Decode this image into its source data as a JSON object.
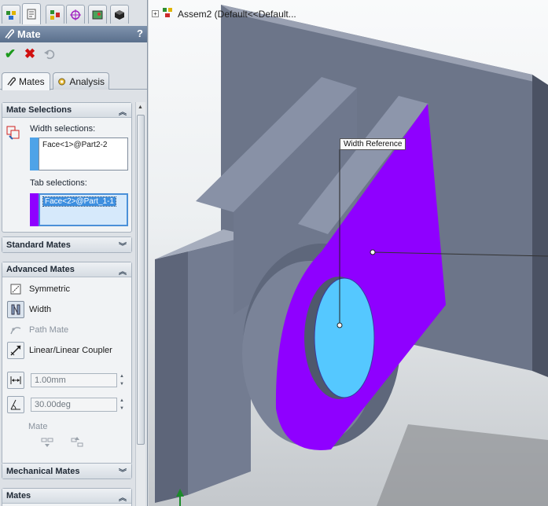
{
  "panel": {
    "title": "Mate",
    "help_label": "?",
    "tabs": {
      "mates": "Mates",
      "analysis": "Analysis"
    },
    "mate_selections": {
      "header": "Mate Selections",
      "width_label": "Width selections:",
      "width_value": "Face<1>@Part2-2",
      "tab_label": "Tab selections:",
      "tab_value": "Face<2>@Part_1-1"
    },
    "standard_mates": {
      "header": "Standard Mates"
    },
    "advanced_mates": {
      "header": "Advanced Mates",
      "items": [
        {
          "label": "Symmetric",
          "icon": "symmetric-icon",
          "selected": false,
          "enabled": true
        },
        {
          "label": "Width",
          "icon": "width-icon",
          "selected": true,
          "enabled": true
        },
        {
          "label": "Path Mate",
          "icon": "path-mate-icon",
          "selected": false,
          "enabled": false
        },
        {
          "label": "Linear/Linear Coupler",
          "icon": "linear-coupler-icon",
          "selected": false,
          "enabled": true
        }
      ],
      "distance_value": "1.00mm",
      "angle_value": "30.00deg",
      "mate_label": "Mate"
    },
    "mechanical_mates": {
      "header": "Mechanical Mates"
    },
    "mates_group": {
      "header": "Mates"
    }
  },
  "viewport": {
    "tree_label": "Assem2  (Default<<Default...",
    "callout": "Width Reference"
  },
  "colors": {
    "part_face": "#8f00ff",
    "selected_face": "#55c8ff",
    "body": "#6e7890",
    "accent_blue": "#3d8fe0"
  }
}
